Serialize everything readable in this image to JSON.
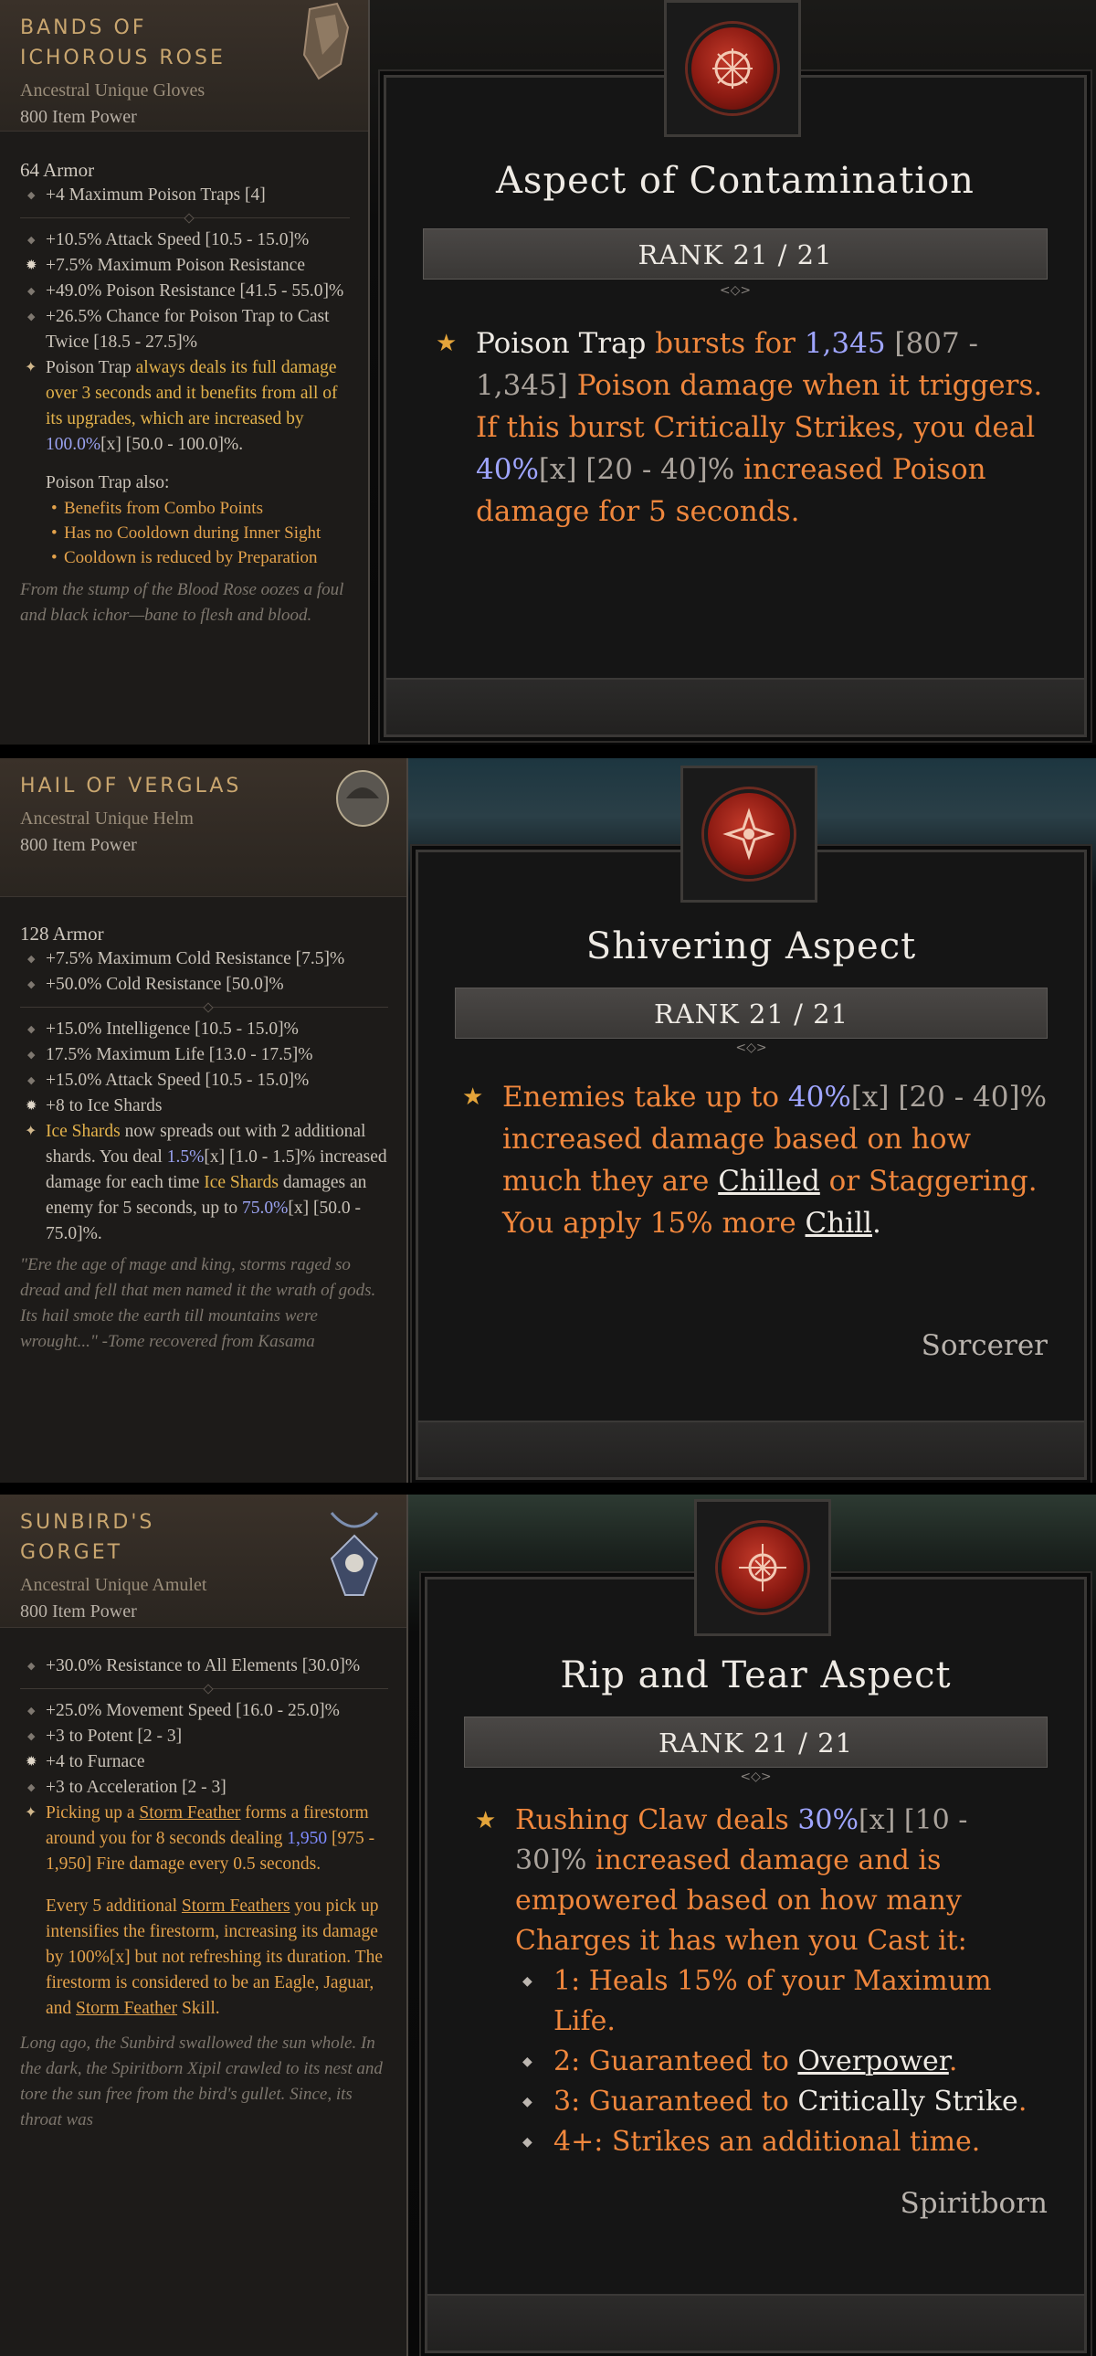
{
  "panels": [
    {
      "item": {
        "name": "BANDS OF ICHOROUS ROSE",
        "type": "Ancestral Unique Gloves",
        "power": "800 Item Power",
        "armor": "64 Armor",
        "implicit": [
          "+4 Maximum Poison Traps [4]"
        ],
        "affixes": [
          "+10.5% Attack Speed [10.5 - 15.0]%",
          "+7.5% Maximum Poison Resistance",
          "+49.0% Poison Resistance [41.5 - 55.0]%",
          "+26.5% Chance for Poison Trap to Cast Twice [18.5 - 27.5]%"
        ],
        "unique_parts": [
          "Poison Trap",
          " always deals its full damage over 3 seconds and it benefits from all of its upgrades, which are increased by ",
          "100.0%",
          "[x] [50.0 - 100.0]%."
        ],
        "also_title": "Poison Trap also:",
        "also": [
          "Benefits from Combo Points",
          "Has no Cooldown during Inner Sight",
          "Cooldown is reduced by Preparation"
        ],
        "flavor": "From the stump of the Blood Rose oozes a foul and black ichor—bane to flesh and blood."
      },
      "aspect": {
        "title": "Aspect of Contamination",
        "rank": "RANK 21 / 21",
        "text_parts": [
          "Poison Trap",
          " bursts for ",
          "1,345",
          " [807 - 1,345] ",
          "Poison damage when it triggers. If this burst Critically Strikes, you deal ",
          "40%",
          "[x] [20 - 40]% ",
          "increased Poison damage for 5 seconds."
        ]
      }
    },
    {
      "item": {
        "name": "HAIL OF VERGLAS",
        "type": "Ancestral Unique Helm",
        "power": "800 Item Power",
        "armor": "128 Armor",
        "implicit": [
          "+7.5% Maximum Cold Resistance [7.5]%",
          "+50.0% Cold Resistance [50.0]%"
        ],
        "affixes": [
          "+15.0% Intelligence [10.5 - 15.0]%",
          "17.5% Maximum Life [13.0 - 17.5]%",
          "+15.0% Attack Speed [10.5 - 15.0]%",
          "+8 to Ice Shards"
        ],
        "unique_parts": [
          "Ice Shards",
          " now spreads out with 2 additional shards. You deal ",
          "1.5%",
          "[x] [1.0 - 1.5]% increased damage for each time ",
          "Ice Shards",
          " damages an enemy for 5 seconds, up to ",
          "75.0%",
          "[x] [50.0 - 75.0]%."
        ],
        "flavor": "\"Ere the age of mage and king, storms raged so dread and fell that men named it the wrath of gods. Its hail smote the earth till mountains were wrought...\" -Tome recovered from Kasama"
      },
      "aspect": {
        "title": "Shivering Aspect",
        "rank": "RANK 21 / 21",
        "text_parts": [
          "Enemies take up to ",
          "40%",
          "[x] [20 - 40]% ",
          "increased damage based on how much they are ",
          "Chilled",
          " or Staggering. You apply 15% more ",
          "Chill",
          "."
        ],
        "class": "Sorcerer"
      }
    },
    {
      "item": {
        "name": "SUNBIRD'S GORGET",
        "type": "Ancestral Unique Amulet",
        "power": "800 Item Power",
        "implicit": [
          "+30.0% Resistance to All Elements [30.0]%"
        ],
        "affixes": [
          "+25.0% Movement Speed [16.0 - 25.0]%",
          "+3 to Potent [2 - 3]",
          "+4 to Furnace",
          "+3 to Acceleration [2 - 3]"
        ],
        "unique_parts": [
          "Picking up a ",
          "Storm Feather",
          " forms a firestorm around you for 8 seconds dealing ",
          "1,950",
          " [975 - 1,950] Fire damage every 0.5 seconds."
        ],
        "unique2_parts": [
          "Every 5 additional ",
          "Storm Feathers",
          " you pick up intensifies the firestorm, increasing its damage by 100%[x] but not refreshing its duration. The firestorm is considered to be an Eagle, Jaguar, and ",
          "Storm Feather",
          " Skill."
        ],
        "flavor": "Long ago, the Sunbird swallowed the sun whole. In the dark, the Spiritborn Xipil crawled to its nest and tore the sun free from the bird's gullet. Since, its throat was"
      },
      "aspect": {
        "title": "Rip and Tear Aspect",
        "rank": "RANK 21 / 21",
        "text_parts": [
          "Rushing Claw deals ",
          "30%",
          "[x] [10 - 30]% ",
          "increased damage and is empowered based on how many Charges it has when you Cast it:"
        ],
        "bullets": [
          [
            "1: Heals 15% of your Maximum Life.",
            "",
            ""
          ],
          [
            "2: Guaranteed to ",
            "Overpower",
            "."
          ],
          [
            "3: Guaranteed to ",
            "Critically Strike",
            "."
          ],
          [
            "4+: Strikes an additional time.",
            "",
            ""
          ]
        ],
        "class": "Spiritborn"
      }
    }
  ]
}
